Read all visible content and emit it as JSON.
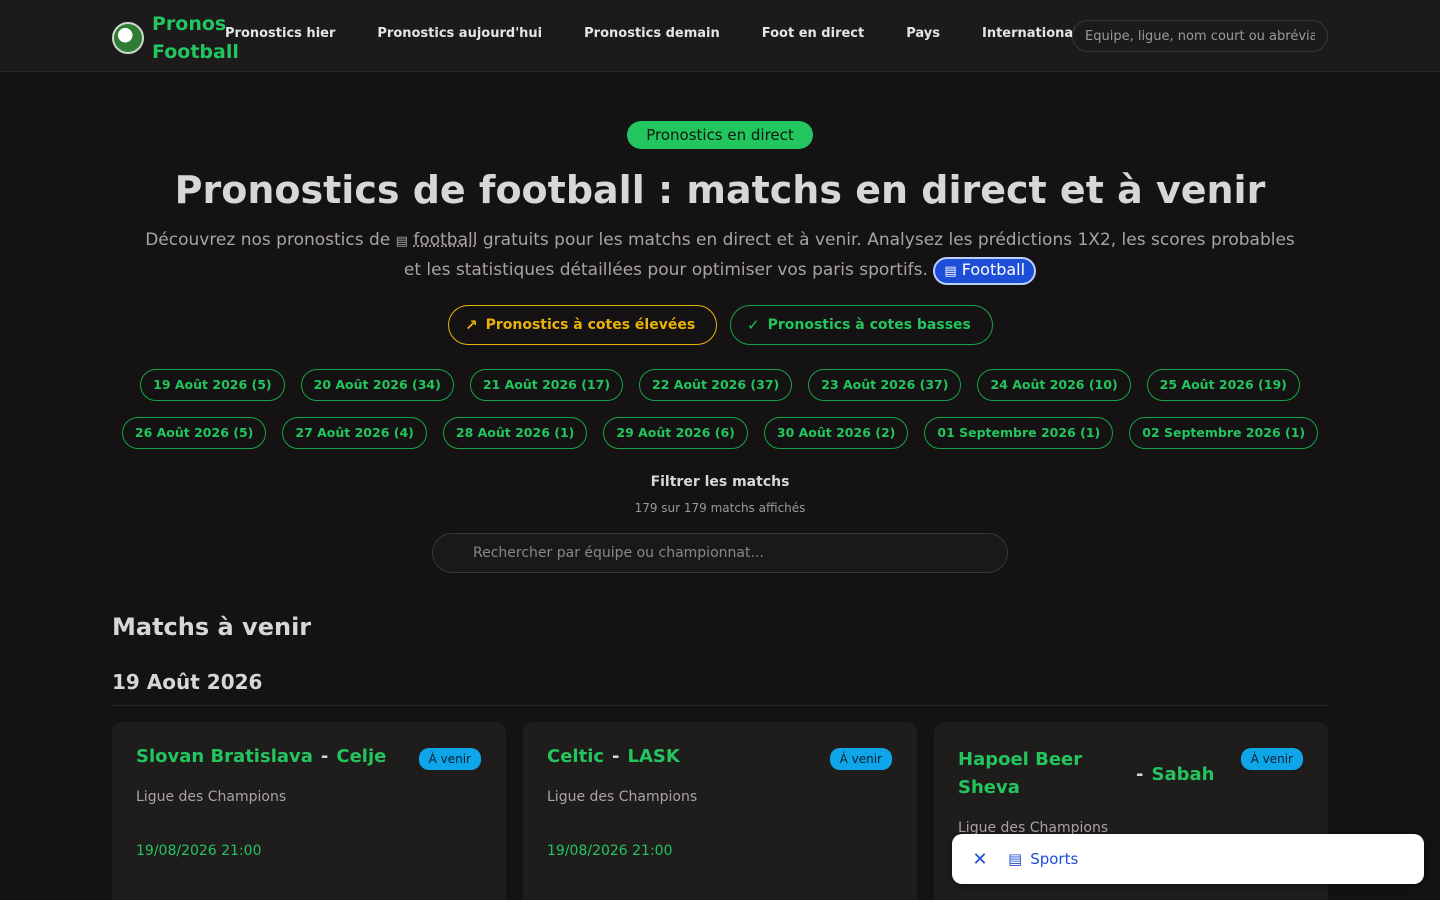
{
  "header": {
    "logo_line1": "Pronos",
    "logo_line2": "Football",
    "nav": [
      "Pronostics hier",
      "Pronostics aujourd'hui",
      "Pronostics demain",
      "Foot en direct",
      "Pays",
      "Internationales"
    ],
    "search_placeholder": "Equipe, ligue, nom court ou abréviat"
  },
  "hero": {
    "badge": "Pronostics en direct",
    "title": "Pronostics de football : matchs en direct et à venir",
    "desc_before": "Découvrez nos pronostics de",
    "desc_keyword": "football",
    "desc_after": "gratuits pour les matchs en direct et à venir. Analysez les prédictions 1X2, les scores probables et les statistiques détaillées pour optimiser vos paris sportifs.",
    "chip": "Football"
  },
  "odds": {
    "high": "Pronostics à cotes élevées",
    "low": "Pronostics à cotes basses"
  },
  "dates_row1": [
    "19 Août 2026 (5)",
    "20 Août 2026 (34)",
    "21 Août 2026 (17)",
    "22 Août 2026 (37)",
    "23 Août 2026 (37)",
    "24 Août 2026 (10)",
    "25 Août 2026 (19)"
  ],
  "dates_row2": [
    "26 Août 2026 (5)",
    "27 Août 2026 (4)",
    "28 Août 2026 (1)",
    "29 Août 2026 (6)",
    "30 Août 2026 (2)",
    "01 Septembre 2026 (1)",
    "02 Septembre 2026 (1)"
  ],
  "filter": {
    "title": "Filtrer les matchs",
    "count": "179 sur 179 matchs affichés",
    "placeholder": "Rechercher par équipe ou championnat..."
  },
  "section_title": "Matchs à venir",
  "day_title": "19 Août 2026",
  "matches": [
    {
      "home": "Slovan Bratislava",
      "away": "Celje",
      "status": "À venir",
      "league": "Ligue des Champions",
      "datetime": "19/08/2026 21:00"
    },
    {
      "home": "Celtic",
      "away": "LASK",
      "status": "À venir",
      "league": "Ligue des Champions",
      "datetime": "19/08/2026 21:00"
    },
    {
      "home": "Hapoel Beer Sheva",
      "away": "Sabah",
      "status": "À venir",
      "league": "Ligue des Champions",
      "datetime": ""
    }
  ],
  "toast": {
    "label": "Sports"
  },
  "colors": {
    "accent": "#22c55e",
    "warning": "#eab308",
    "info": "#0ea5e9",
    "link": "#1d4ed8"
  }
}
